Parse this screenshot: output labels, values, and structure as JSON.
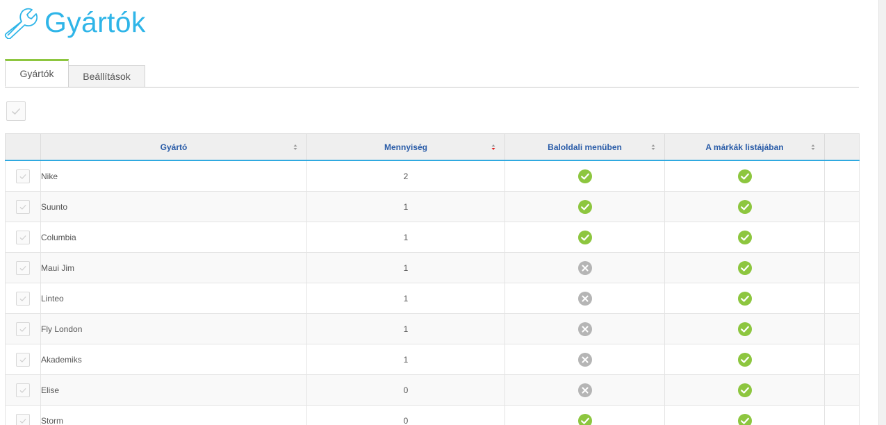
{
  "header": {
    "title": "Gyártók",
    "icon": "wrench-icon",
    "title_color": "#2fb5e8"
  },
  "tabs": [
    {
      "label": "Gyártók",
      "active": true
    },
    {
      "label": "Beállítások",
      "active": false
    }
  ],
  "table": {
    "columns": [
      {
        "label": "",
        "sort": "none"
      },
      {
        "label": "Gyártó",
        "sort": "none"
      },
      {
        "label": "Mennyiség",
        "sort": "desc"
      },
      {
        "label": "Baloldali menüben",
        "sort": "none"
      },
      {
        "label": "A márkák listájában",
        "sort": "none"
      },
      {
        "label": "",
        "sort": "none"
      }
    ],
    "rows": [
      {
        "name": "Nike",
        "quantity": "2",
        "left_menu": true,
        "brand_list": true
      },
      {
        "name": "Suunto",
        "quantity": "1",
        "left_menu": true,
        "brand_list": true
      },
      {
        "name": "Columbia",
        "quantity": "1",
        "left_menu": true,
        "brand_list": true
      },
      {
        "name": "Maui Jim",
        "quantity": "1",
        "left_menu": false,
        "brand_list": true
      },
      {
        "name": "Linteo",
        "quantity": "1",
        "left_menu": false,
        "brand_list": true
      },
      {
        "name": "Fly London",
        "quantity": "1",
        "left_menu": false,
        "brand_list": true
      },
      {
        "name": "Akademiks",
        "quantity": "1",
        "left_menu": false,
        "brand_list": true
      },
      {
        "name": "Elise",
        "quantity": "0",
        "left_menu": false,
        "brand_list": true
      },
      {
        "name": "Storm",
        "quantity": "0",
        "left_menu": true,
        "brand_list": true
      }
    ]
  },
  "colors": {
    "accent": "#2fb5e8",
    "tab_active_border": "#8dc63f",
    "status_yes": "#8dc63f",
    "status_no": "#b5b5b5",
    "header_text": "#2a5ca8",
    "sort_active": "#e02020"
  }
}
